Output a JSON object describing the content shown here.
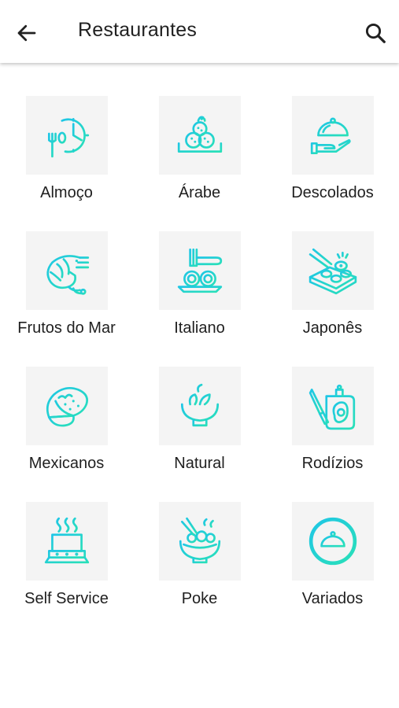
{
  "header": {
    "title": "Restaurantes",
    "back_icon": "arrow-left-icon",
    "search_icon": "search-icon"
  },
  "colors": {
    "icon_gradient_start": "#1fc6e6",
    "icon_gradient_end": "#29e0b8",
    "tile_background": "#f4f4f4"
  },
  "categories": [
    {
      "label": "Almoço",
      "icon": "clock-fork-spoon-icon"
    },
    {
      "label": "Árabe",
      "icon": "kibbeh-plate-icon"
    },
    {
      "label": "Descolados",
      "icon": "cloche-hand-icon"
    },
    {
      "label": "Frutos do Mar",
      "icon": "shrimp-icon"
    },
    {
      "label": "Italiano",
      "icon": "spaghetti-fork-icon"
    },
    {
      "label": "Japonês",
      "icon": "sushi-board-icon"
    },
    {
      "label": "Mexicanos",
      "icon": "taco-icon"
    },
    {
      "label": "Natural",
      "icon": "salad-bowl-icon"
    },
    {
      "label": "Rodízios",
      "icon": "meat-board-knife-icon"
    },
    {
      "label": "Self Service",
      "icon": "food-warmer-icon"
    },
    {
      "label": "Poke",
      "icon": "poke-bowl-icon"
    },
    {
      "label": "Variados",
      "icon": "cloche-circle-icon"
    }
  ]
}
